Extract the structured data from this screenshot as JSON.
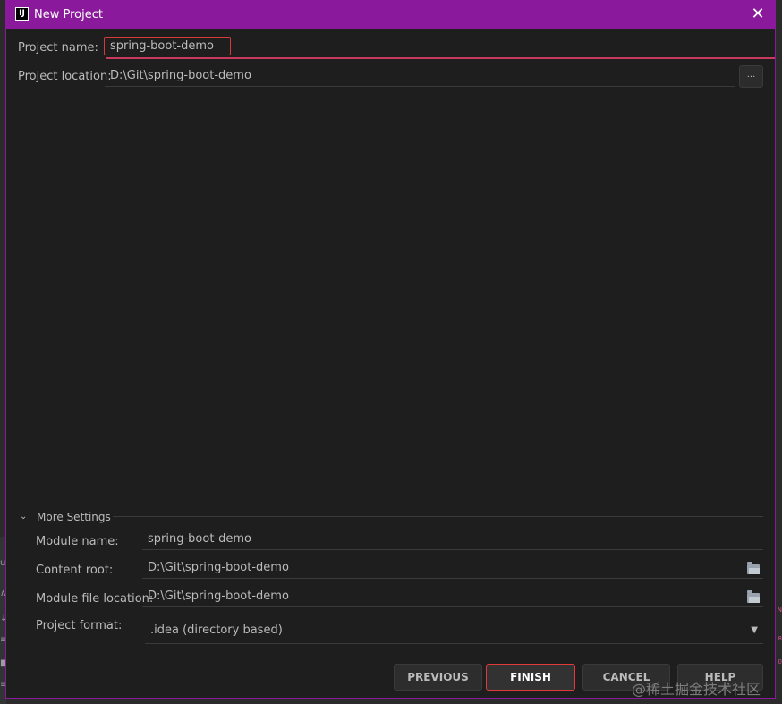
{
  "window": {
    "title": "New Project",
    "icon": "intellij-logo-icon",
    "icon_text": "IJ",
    "title_bar_color": "#8a1a9b"
  },
  "project": {
    "name_label": "Project name:",
    "name_value": "spring-boot-demo",
    "location_label": "Project location:",
    "location_value": "D:\\Git\\spring-boot-demo",
    "browse_label": "..."
  },
  "more_settings": {
    "label": "More Settings",
    "module_name_label": "Module name:",
    "module_name_value": "spring-boot-demo",
    "content_root_label": "Content root:",
    "content_root_value": "D:\\Git\\spring-boot-demo",
    "module_file_location_label": "Module file location:",
    "module_file_location_value": "D:\\Git\\spring-boot-demo",
    "project_format_label": "Project format:",
    "project_format_value": ".idea (directory based)"
  },
  "buttons": {
    "previous": "PREVIOUS",
    "finish": "FINISH",
    "cancel": "CANCEL",
    "help": "HELP"
  },
  "colors": {
    "accent": "#8a1a9b",
    "highlight": "#d83a3a",
    "background": "#1e1e1e"
  },
  "watermark": "@稀土掘金技术社区"
}
